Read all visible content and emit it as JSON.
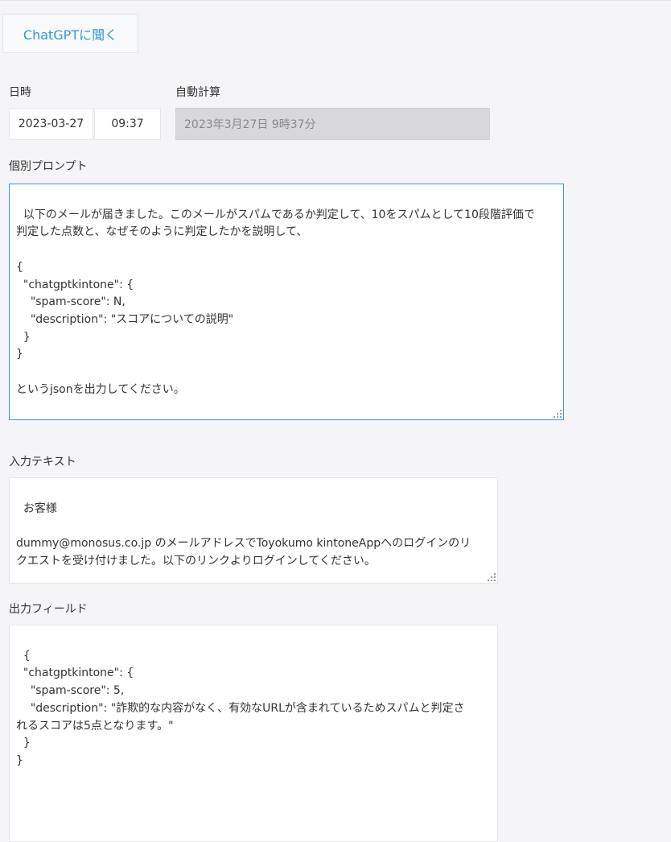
{
  "ask_button_label": "ChatGPTに聞く",
  "datetime": {
    "label": "日時",
    "date": "2023-03-27",
    "time": "09:37"
  },
  "auto_calc": {
    "label": "自動計算",
    "value": "2023年3月27日 9時37分"
  },
  "prompt": {
    "label": "個別プロンプト",
    "text": "以下のメールが届きました。このメールがスパムであるか判定して、10をスパムとして10段階評価で\n判定した点数と、なぜそのように判定したかを説明して、\n\n{\n  \"chatgptkintone\": {\n    \"spam-score\": N,\n    \"description\": \"スコアについての説明\"\n  }\n}\n\nというjsonを出力してください。"
  },
  "input_text": {
    "label": "入力テキスト",
    "text": "お客様\n\ndummy@monosus.co.jp のメールアドレスでToyokumo kintoneAppへのログインのリ\nクエストを受け付けました。以下のリンクよりログインしてください。\n\nToyokumo kintoneApp にログイン"
  },
  "output_field": {
    "label": "出力フィールド",
    "text": "{\n  \"chatgptkintone\": {\n    \"spam-score\": 5,\n    \"description\": \"詐欺的な内容がなく、有効なURLが含まれているためスパムと判定さ\nれるスコアは5点となります。\"\n  }\n}"
  },
  "colors": {
    "accent": "#3498db",
    "background": "#f5f5f7",
    "readonly_bg": "#d8d8db"
  }
}
